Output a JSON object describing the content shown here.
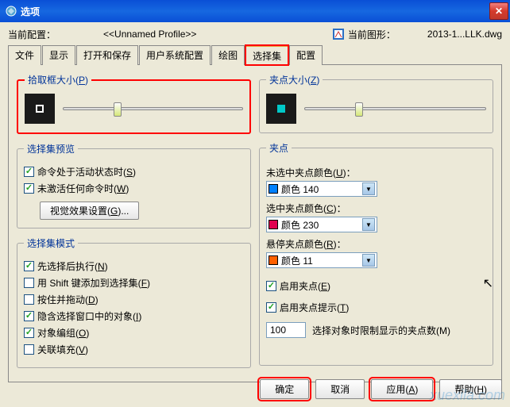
{
  "window": {
    "title": "选项"
  },
  "profile": {
    "currentConfigLabel": "当前配置：",
    "currentConfigValue": "<<Unnamed Profile>>",
    "currentDrawingLabel": "当前图形：",
    "currentDrawingValue": "2013-1...LLK.dwg"
  },
  "tabs": [
    "文件",
    "显示",
    "打开和保存",
    "用户系统配置",
    "绘图",
    "选择集",
    "配置"
  ],
  "pickbox": {
    "legend": "拾取框大小(",
    "legendU": "P",
    "legendEnd": ")"
  },
  "gripsize": {
    "legend": "夹点大小(",
    "legendU": "Z",
    "legendEnd": ")"
  },
  "preview": {
    "legend": "选择集预览",
    "chk1": "命令处于活动状态时(",
    "chk1u": "S",
    "chk1end": ")",
    "chk2": "未激活任何命令时(",
    "chk2u": "W",
    "chk2end": ")",
    "btn": "视觉效果设置(",
    "btnU": "G",
    "btnEnd": ")..."
  },
  "modes": {
    "legend": "选择集模式",
    "chk1": "先选择后执行(",
    "chk1u": "N",
    "chk1end": ")",
    "chk2": "用 Shift 键添加到选择集(",
    "chk2u": "F",
    "chk2end": ")",
    "chk3": "按住并拖动(",
    "chk3u": "D",
    "chk3end": ")",
    "chk4": "隐含选择窗口中的对象(",
    "chk4u": "I",
    "chk4end": ")",
    "chk5": "对象编组(",
    "chk5u": "O",
    "chk5end": ")",
    "chk6": "关联填充(",
    "chk6u": "V",
    "chk6end": ")"
  },
  "grips": {
    "legend": "夹点",
    "unselLabel": "未选中夹点颜色(",
    "unselU": "U",
    "unselEnd": ")：",
    "unselColor": "#0080ff",
    "unselText": "颜色 140",
    "selLabel": "选中夹点颜色(",
    "selU": "C",
    "selEnd": ")：",
    "selColor": "#e00050",
    "selText": "颜色 230",
    "hoverLabel": "悬停夹点颜色(",
    "hoverU": "R",
    "hoverEnd": ")：",
    "hoverColor": "#ff6000",
    "hoverText": "颜色 11",
    "enableGrips": "启用夹点(",
    "enableGripsU": "E",
    "enableGripsEnd": ")",
    "enableTips": "启用夹点提示(",
    "enableTipsU": "T",
    "enableTipsEnd": ")",
    "limitLabel": "选择对象时限制显示的夹点数(",
    "limitU": "M",
    "limitEnd": ")",
    "limitValue": "100"
  },
  "buttons": {
    "ok": "确定",
    "cancel": "取消",
    "apply": "应用(",
    "applyU": "A",
    "applyEnd": ")",
    "help": "帮助(",
    "helpU": "H",
    "helpEnd": ")"
  },
  "watermark": "xuexila.com"
}
